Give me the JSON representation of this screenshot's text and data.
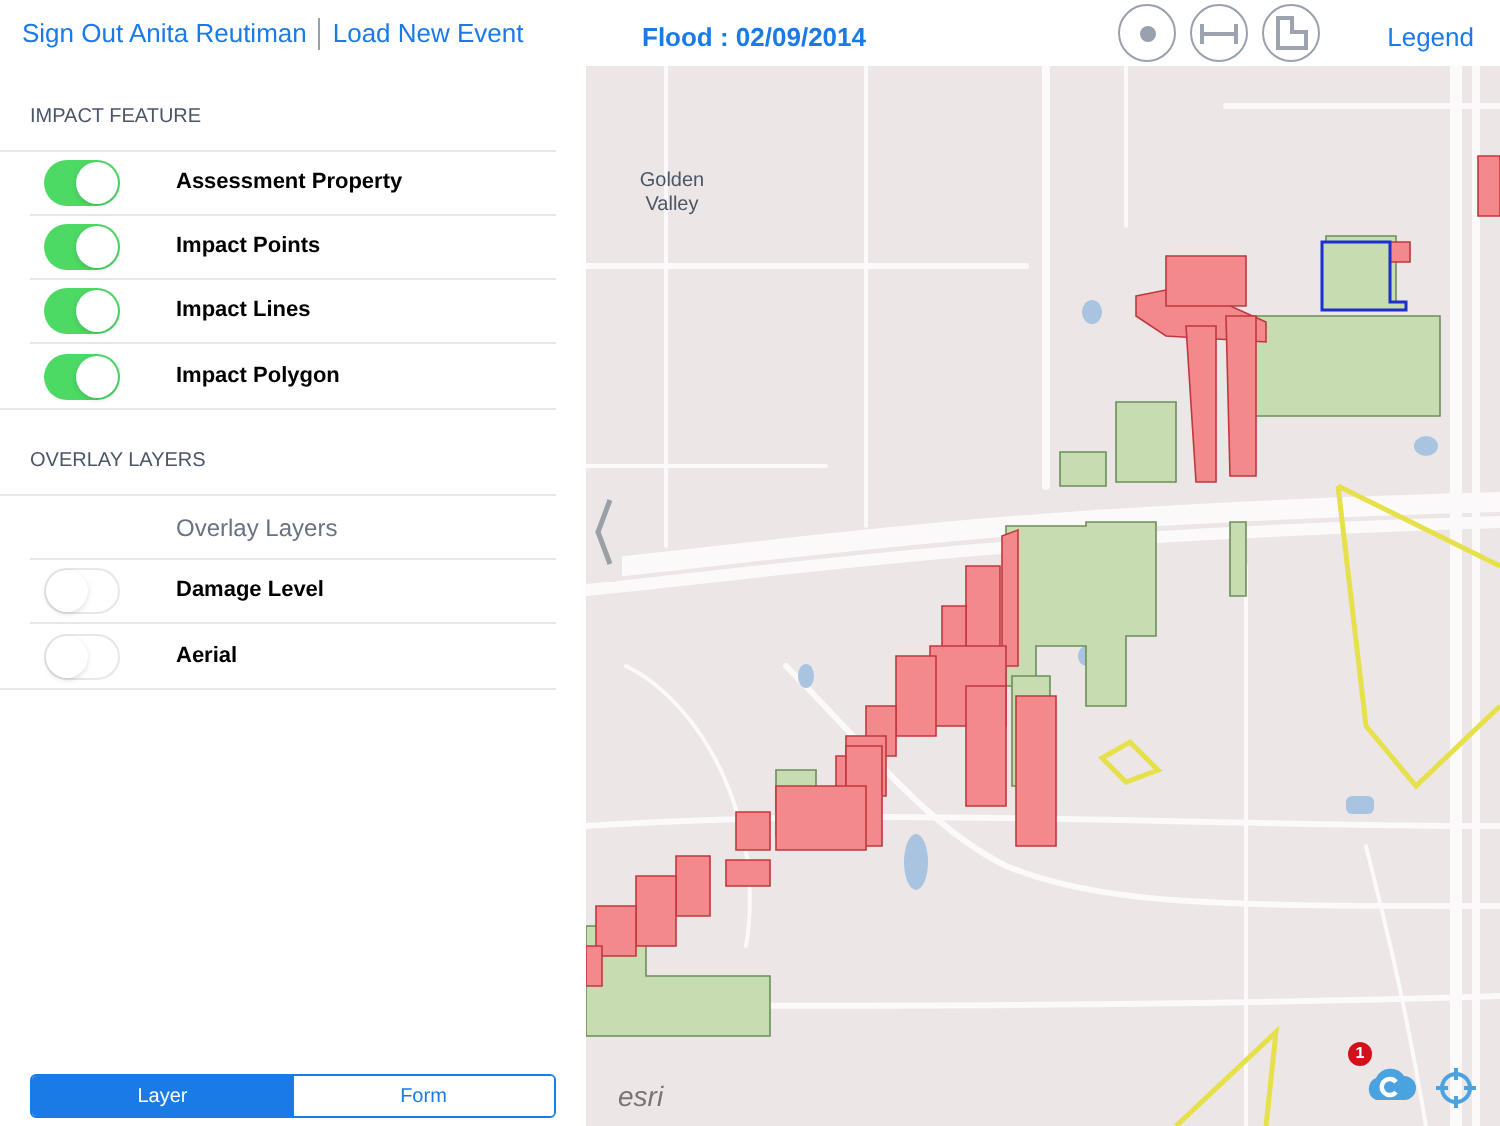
{
  "header": {
    "sign_out": "Sign Out Anita Reutiman",
    "load_event": "Load New Event",
    "title": "Flood : 02/09/2014",
    "legend": "Legend"
  },
  "impact_feature": {
    "heading": "IMPACT FEATURE",
    "rows": [
      {
        "label": "Assessment Property",
        "on": true
      },
      {
        "label": "Impact Points",
        "on": true
      },
      {
        "label": "Impact Lines",
        "on": true
      },
      {
        "label": "Impact Polygon",
        "on": true
      }
    ]
  },
  "overlay_layers": {
    "heading": "OVERLAY LAYERS",
    "rows": [
      {
        "kind": "hint",
        "label": "Overlay Layers"
      },
      {
        "kind": "toggle",
        "label": "Damage Level",
        "on": false
      },
      {
        "kind": "toggle",
        "label": "Aerial",
        "on": false
      }
    ]
  },
  "segments": [
    {
      "label": "Layer",
      "selected": true
    },
    {
      "label": "Form",
      "selected": false
    }
  ],
  "map": {
    "place_label": "Golden Valley",
    "logo": "esri",
    "sync_badge": "1"
  }
}
